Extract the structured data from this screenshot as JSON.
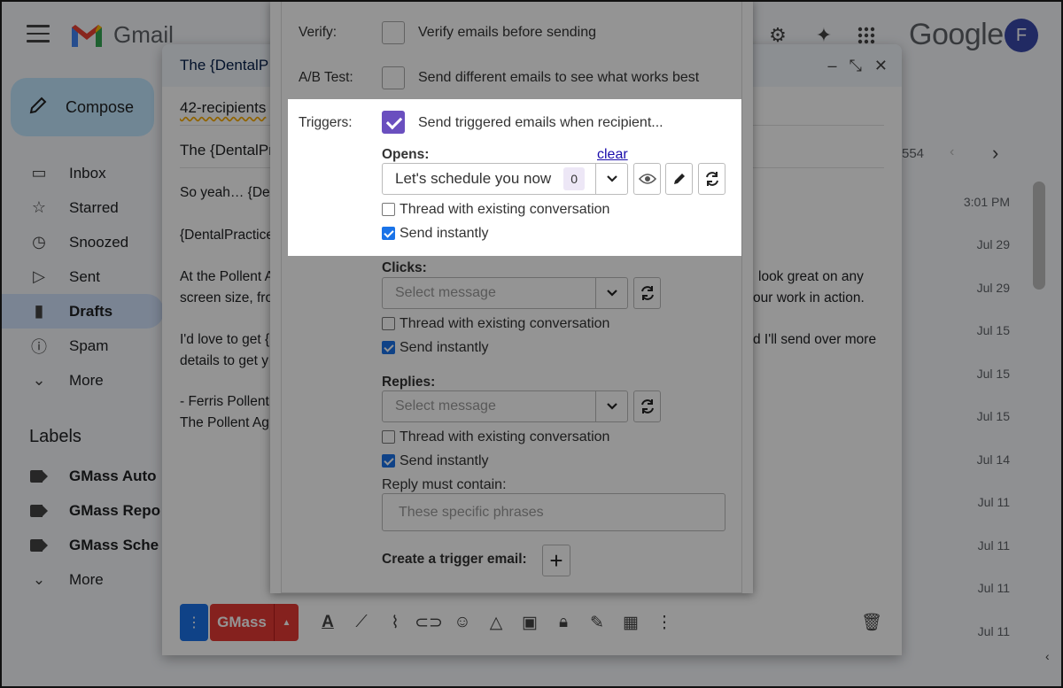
{
  "gmail": {
    "app_name": "Gmail",
    "google_word": "Google",
    "avatar_letter": "F",
    "compose_label": "Compose",
    "nav": [
      {
        "label": "Inbox",
        "icon": "inbox-icon"
      },
      {
        "label": "Starred",
        "icon": "star-icon"
      },
      {
        "label": "Snoozed",
        "icon": "clock-icon"
      },
      {
        "label": "Sent",
        "icon": "send-icon"
      },
      {
        "label": "Drafts",
        "icon": "draft-icon"
      },
      {
        "label": "Spam",
        "icon": "spam-icon"
      },
      {
        "label": "More",
        "icon": "chevron-down-icon"
      }
    ],
    "labels_heading": "Labels",
    "labels": [
      "GMass Auto",
      "GMass Repo",
      "GMass Sche"
    ],
    "labels_more": "More",
    "pager": "554",
    "dates": [
      "3:01 PM",
      "Jul 29",
      "Jul 29",
      "Jul 15",
      "Jul 15",
      "Jul 15",
      "Jul 14",
      "Jul 11",
      "Jul 11",
      "Jul 11",
      "Jul 11"
    ]
  },
  "compose": {
    "title": "The {DentalP",
    "recipients": "42-recipients",
    "subject": "The {DentalPr",
    "body_lines": [
      "So yeah… {De",
      "{DentalPractice",
      "At the Pollent A",
      "screen size, fro",
      "I'd love to get {",
      "details to get y",
      "- Ferris Pollent",
      "The Pollent Ag"
    ],
    "body_right_lines": [
      "look great on any",
      "our work in action.",
      "d I'll send over more"
    ],
    "gmass_label": "GMass"
  },
  "settings": {
    "verify_label": "Verify:",
    "verify_text": "Verify emails before sending",
    "ab_label": "A/B Test:",
    "ab_text": "Send different emails to see what works best",
    "triggers_label": "Triggers:",
    "triggers_text": "Send triggered emails when recipient...",
    "opens": {
      "label": "Opens:",
      "clear": "clear",
      "selected": "Let's schedule you now",
      "count": "0",
      "thread": "Thread with existing conversation",
      "instant": "Send instantly"
    },
    "clicks": {
      "label": "Clicks:",
      "placeholder": "Select message",
      "thread": "Thread with existing conversation",
      "instant": "Send instantly"
    },
    "replies": {
      "label": "Replies:",
      "placeholder": "Select message",
      "thread": "Thread with existing conversation",
      "instant": "Send instantly",
      "must_contain": "Reply must contain:",
      "phrases_placeholder": "These specific phrases"
    },
    "create_trigger": "Create a trigger email:"
  }
}
